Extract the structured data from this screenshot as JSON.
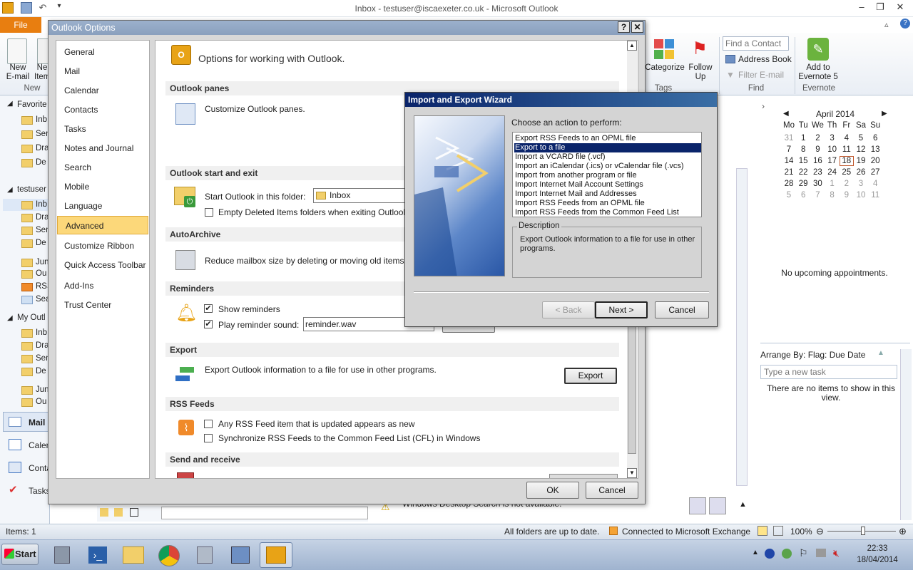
{
  "window": {
    "title": "Inbox - testuser@iscaexeter.co.uk  -  Microsoft Outlook",
    "file_tab": "File"
  },
  "ribbon": {
    "new_email": "New\nE-mail",
    "new_items": "Ne\nItem",
    "group_new": "New",
    "categorize": "Categorize",
    "follow_up": "Follow\nUp",
    "group_tags": "Tags",
    "find_contact_placeholder": "Find a Contact",
    "address_book": "Address Book",
    "filter_email": "Filter E-mail",
    "group_find": "Find",
    "add_to_evernote": "Add to\nEvernote 5",
    "group_evernote": "Evernote"
  },
  "navpane": {
    "favorites": "Favorite",
    "fav_items": [
      "Inb",
      "Sen",
      "Dra",
      "De"
    ],
    "account": "testuser",
    "account_items": [
      "Inb",
      "Dra",
      "Sen",
      "De",
      "Jun",
      "Ou",
      "RSS",
      "Sea"
    ],
    "my_outlook": "My Outl",
    "my_items": [
      "Inb",
      "Dra",
      "Sen",
      "De",
      "Jun",
      "Ou"
    ],
    "mail": "Mail",
    "calendar": "Caler",
    "contacts": "Conta",
    "tasks": "Tasks"
  },
  "options_dialog": {
    "title": "Outlook Options",
    "help_btn": "?",
    "close_btn": "✕",
    "nav": [
      "General",
      "Mail",
      "Calendar",
      "Contacts",
      "Tasks",
      "Notes and Journal",
      "Search",
      "Mobile",
      "Language",
      "Advanced",
      "Customize Ribbon",
      "Quick Access Toolbar",
      "Add-Ins",
      "Trust Center"
    ],
    "selected_nav": "Advanced",
    "heading": "Options for working with Outlook.",
    "sec_panes": "Outlook panes",
    "panes_text": "Customize Outlook panes.",
    "sec_start": "Outlook start and exit",
    "start_folder_label": "Start Outlook in this folder:",
    "start_folder_value": "Inbox",
    "empty_deleted": "Empty Deleted Items folders when exiting Outlook",
    "sec_archive": "AutoArchive",
    "archive_text": "Reduce mailbox size by deleting or moving old items to",
    "sec_reminders": "Reminders",
    "show_reminders": "Show reminders",
    "play_sound": "Play reminder sound:",
    "sound_file": "reminder.wav",
    "sec_export": "Export",
    "export_text": "Export Outlook information to a file for use in other programs.",
    "export_btn": "Export",
    "sec_rss": "RSS Feeds",
    "rss_any": "Any RSS Feed item that is updated appears as new",
    "rss_sync": "Synchronize RSS Feeds to the Common Feed List (CFL) in Windows",
    "sec_send": "Send and receive",
    "ok": "OK",
    "cancel": "Cancel"
  },
  "wizard": {
    "title": "Import and Export Wizard",
    "prompt": "Choose an action to perform:",
    "actions": [
      "Export RSS Feeds to an OPML file",
      "Export to a file",
      "Import a VCARD file (.vcf)",
      "Import an iCalendar (.ics) or vCalendar file (.vcs)",
      "Import from another program or file",
      "Import Internet Mail Account Settings",
      "Import Internet Mail and Addresses",
      "Import RSS Feeds from an OPML file",
      "Import RSS Feeds from the Common Feed List"
    ],
    "selected_index": 1,
    "desc_label": "Description",
    "desc_text": "Export Outlook information to a file for use in other programs.",
    "back": "< Back",
    "next": "Next >",
    "cancel": "Cancel"
  },
  "todo_bar": {
    "month": "April 2014",
    "weekdays": [
      "Mo",
      "Tu",
      "We",
      "Th",
      "Fr",
      "Sa",
      "Su"
    ],
    "weeks": [
      [
        "31",
        "1",
        "2",
        "3",
        "4",
        "5",
        "6"
      ],
      [
        "7",
        "8",
        "9",
        "10",
        "11",
        "12",
        "13"
      ],
      [
        "14",
        "15",
        "16",
        "17",
        "18",
        "19",
        "20"
      ],
      [
        "21",
        "22",
        "23",
        "24",
        "25",
        "26",
        "27"
      ],
      [
        "28",
        "29",
        "30",
        "1",
        "2",
        "3",
        "4"
      ],
      [
        "5",
        "6",
        "7",
        "8",
        "9",
        "10",
        "11"
      ]
    ],
    "today": "18",
    "no_appointments": "No upcoming appointments.",
    "arrange_by": "Arrange By: Flag: Due Date",
    "task_placeholder": "Type a new task",
    "no_items": "There are no items to show in this view."
  },
  "under_dialog": {
    "desktop_search": "Windows Desktop Search is not available."
  },
  "statusbar": {
    "items": "Items: 1",
    "folders": "All folders are up to date.",
    "exchange": "Connected to Microsoft Exchange",
    "zoom": "100%"
  },
  "taskbar": {
    "start": "Start",
    "time": "22:33",
    "date": "18/04/2014"
  },
  "colors": {
    "accent_file": "#e87e10",
    "selection": "#0a246a",
    "nav_selected": "#fcd87a"
  }
}
